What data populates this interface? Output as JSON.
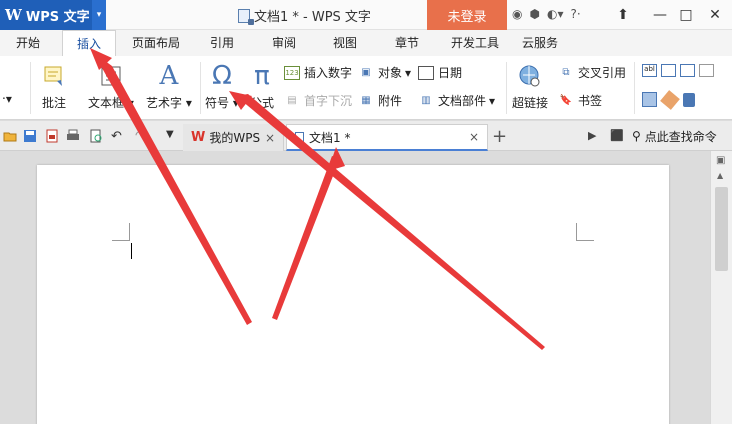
{
  "app": {
    "logo": "W",
    "name": "WPS 文字",
    "dropdown": "▾"
  },
  "window": {
    "title": "文档1 * - WPS 文字",
    "login": "未登录",
    "icons": [
      "skin-icon",
      "shield-icon",
      "sync-icon",
      "help-icon"
    ],
    "help_text": "?·",
    "controls": {
      "upload": "⬆",
      "minimize": "—",
      "maximize": "□",
      "close": "✕"
    }
  },
  "menu": {
    "tabs": [
      "开始",
      "插入",
      "页面布局",
      "引用",
      "审阅",
      "视图",
      "章节",
      "开发工具",
      "云服务"
    ],
    "active": "插入"
  },
  "ribbon": {
    "comment": "批注",
    "textbox": "文本框",
    "wordart": "艺术字",
    "symbol": "符号",
    "formula": "公式",
    "insert_number": "插入数字",
    "first_sink": "首字下沉",
    "object": "对象",
    "attachment": "附件",
    "date": "日期",
    "doc_parts": "文档部件",
    "hyperlink": "超链接",
    "cross_ref": "交叉引用",
    "bookmark": "书签",
    "omega": "Ω",
    "pi": "π",
    "a_glyph": "A"
  },
  "doc_tabs": {
    "wps_tab": "我的WPS",
    "doc_tab": "文档1 *",
    "close": "×",
    "add": "+",
    "search_cmd": "点此查找命令"
  },
  "colors": {
    "accent": "#1f5fb8",
    "login": "#e8704b",
    "arrow": "#e83a3a"
  }
}
